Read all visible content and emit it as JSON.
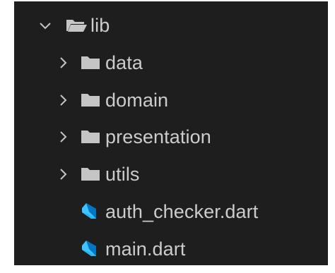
{
  "explorer": {
    "root": {
      "label": "lib",
      "expanded": true
    },
    "items": [
      {
        "label": "data",
        "type": "folder"
      },
      {
        "label": "domain",
        "type": "folder"
      },
      {
        "label": "presentation",
        "type": "folder"
      },
      {
        "label": "utils",
        "type": "folder"
      },
      {
        "label": "auth_checker.dart",
        "type": "file"
      },
      {
        "label": "main.dart",
        "type": "file"
      }
    ]
  },
  "colors": {
    "background": "#1e1e1e",
    "text": "#cccccc",
    "folder_icon": "#c5c5c5",
    "dart_light": "#40c4ff",
    "dart_dark": "#0175c2"
  },
  "icons": {
    "root_chevron": "chevron-down-icon",
    "folder_chevron": "chevron-right-icon",
    "root_folder": "folder-open-icon",
    "folder": "folder-icon",
    "file": "dart-file-icon"
  }
}
